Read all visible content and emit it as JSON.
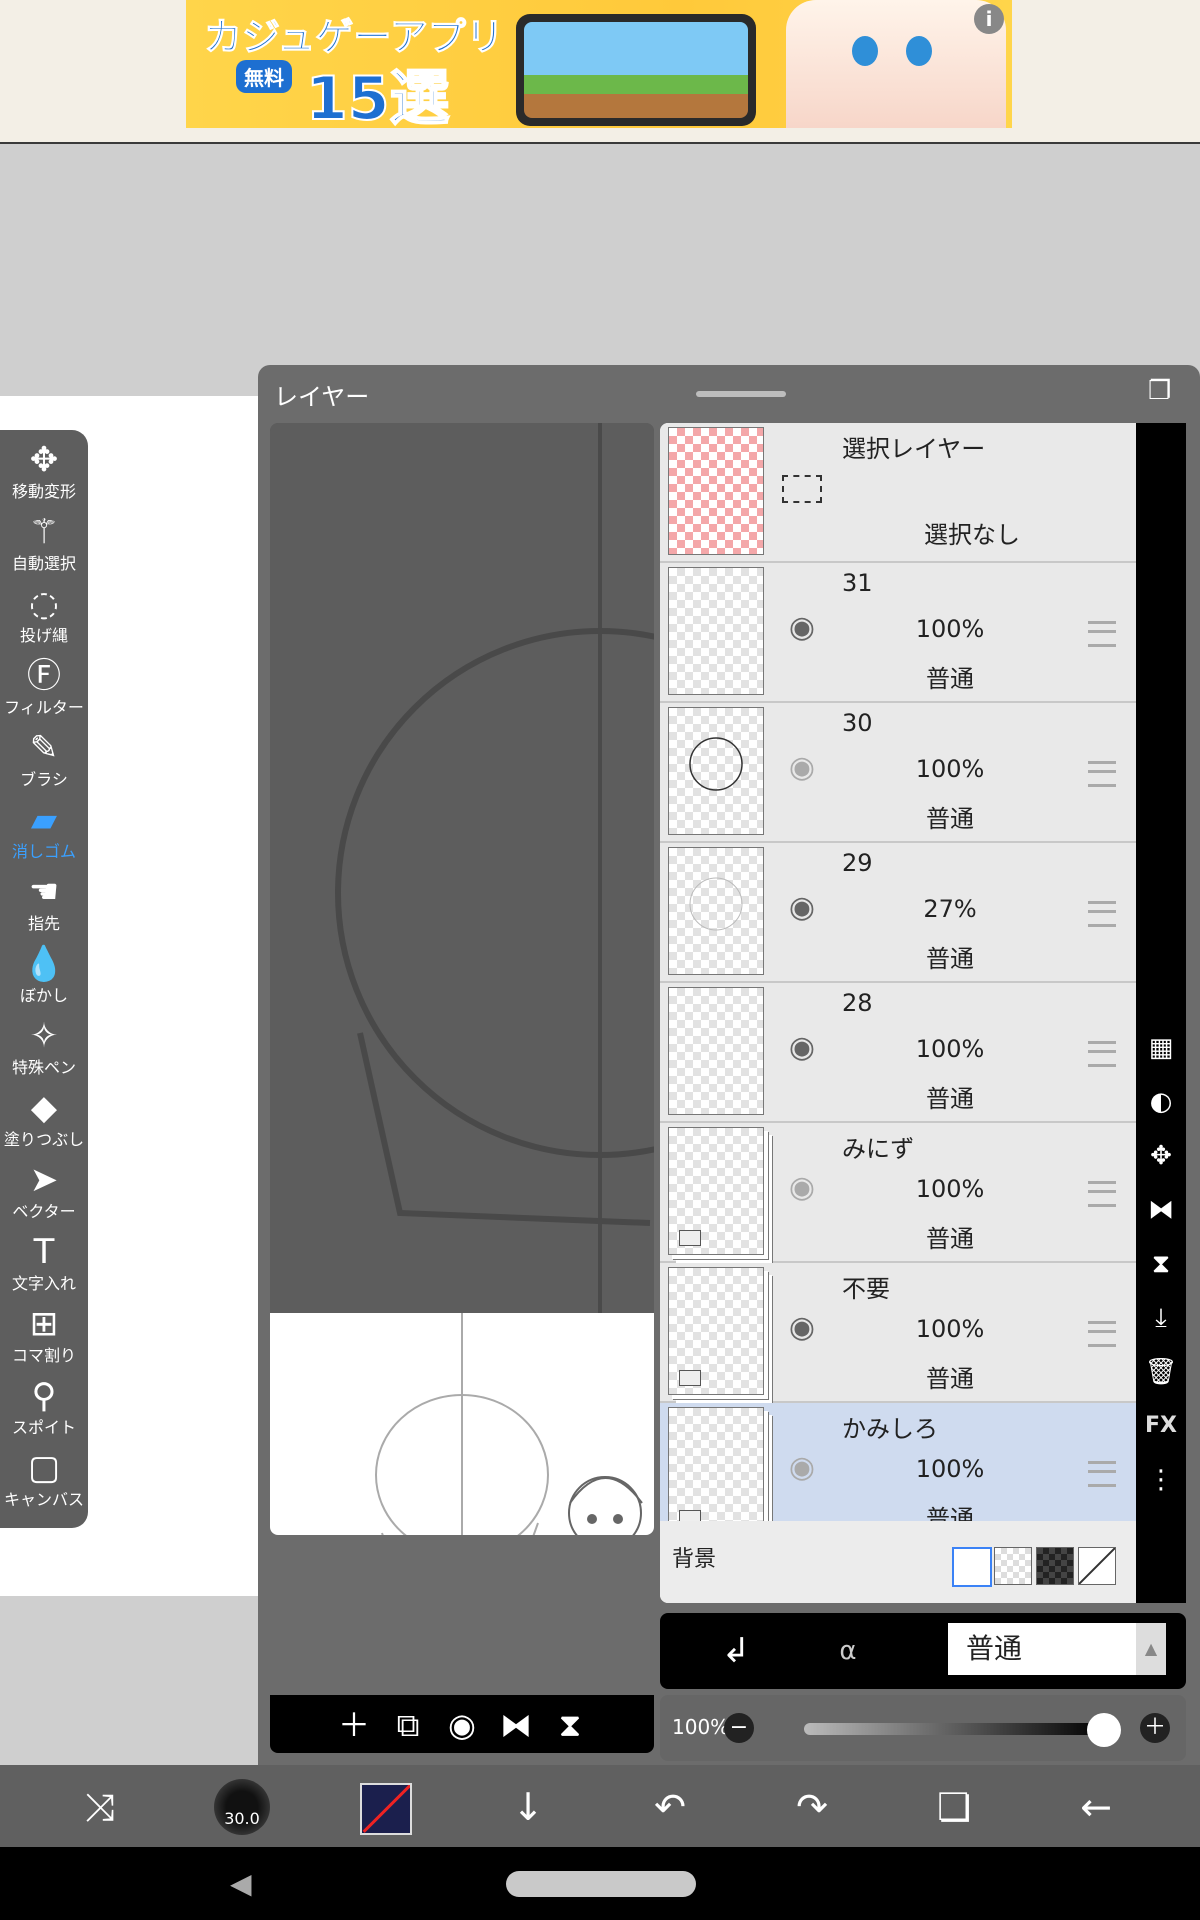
{
  "ad": {
    "line1": "カジュゲーアプリ",
    "badge": "無料",
    "line2": "15選",
    "info": "i"
  },
  "toolbar": {
    "active": "eraser",
    "tools": [
      {
        "id": "move",
        "label": "移動変形",
        "icon": "move-icon",
        "glyph": "✥"
      },
      {
        "id": "magic",
        "label": "自動選択",
        "icon": "magic-wand-icon",
        "glyph": "⚚"
      },
      {
        "id": "lasso",
        "label": "投げ縄",
        "icon": "lasso-icon",
        "glyph": "◌"
      },
      {
        "id": "filter",
        "label": "フィルター",
        "icon": "fx-icon",
        "glyph": "Ⓕ"
      },
      {
        "id": "brush",
        "label": "ブラシ",
        "icon": "brush-icon",
        "glyph": "✎"
      },
      {
        "id": "eraser",
        "label": "消しゴム",
        "icon": "eraser-icon",
        "glyph": "▰"
      },
      {
        "id": "smudge",
        "label": "指先",
        "icon": "finger-icon",
        "glyph": "☚"
      },
      {
        "id": "blur",
        "label": "ぼかし",
        "icon": "drop-icon",
        "glyph": "💧"
      },
      {
        "id": "special",
        "label": "特殊ペン",
        "icon": "sparkle-pen-icon",
        "glyph": "✧"
      },
      {
        "id": "fill",
        "label": "塗りつぶし",
        "icon": "bucket-icon",
        "glyph": "◆"
      },
      {
        "id": "vector",
        "label": "ベクター",
        "icon": "cursor-icon",
        "glyph": "➤"
      },
      {
        "id": "text",
        "label": "文字入れ",
        "icon": "text-icon",
        "glyph": "T"
      },
      {
        "id": "frame",
        "label": "コマ割り",
        "icon": "frame-icon",
        "glyph": "⊞"
      },
      {
        "id": "eyedrop",
        "label": "スポイト",
        "icon": "eyedropper-icon",
        "glyph": "⚲"
      },
      {
        "id": "canvas",
        "label": "キャンバス",
        "icon": "canvas-icon",
        "glyph": "▢"
      }
    ]
  },
  "panel": {
    "title": "レイヤー",
    "selection_layer": {
      "name": "選択レイヤー",
      "status": "選択なし"
    },
    "layers": [
      {
        "name": "31",
        "opacity": "100%",
        "mode": "普通",
        "visible": true,
        "folder": false
      },
      {
        "name": "30",
        "opacity": "100%",
        "mode": "普通",
        "visible": false,
        "folder": false
      },
      {
        "name": "29",
        "opacity": "27%",
        "mode": "普通",
        "visible": true,
        "folder": false
      },
      {
        "name": "28",
        "opacity": "100%",
        "mode": "普通",
        "visible": true,
        "folder": false
      },
      {
        "name": "みにず",
        "opacity": "100%",
        "mode": "普通",
        "visible": false,
        "folder": true
      },
      {
        "name": "不要",
        "opacity": "100%",
        "mode": "普通",
        "visible": true,
        "folder": true
      },
      {
        "name": "かみしろ",
        "opacity": "100%",
        "mode": "普通",
        "visible": false,
        "folder": true,
        "selected": true
      }
    ],
    "background_label": "背景",
    "blend_mode": "普通",
    "opacity_label": "100%",
    "opacity_value": 1.0
  },
  "side_icons": [
    "checker-icon",
    "contrast-icon",
    "move-icon",
    "flip-horizontal-icon",
    "flip-vertical-icon",
    "merge-down-icon",
    "trash-icon",
    "fx-icon",
    "more-icon"
  ],
  "side_fx_label": "FX",
  "bottombar": {
    "brush_size": "30.0",
    "color": "#1b1f4d"
  }
}
